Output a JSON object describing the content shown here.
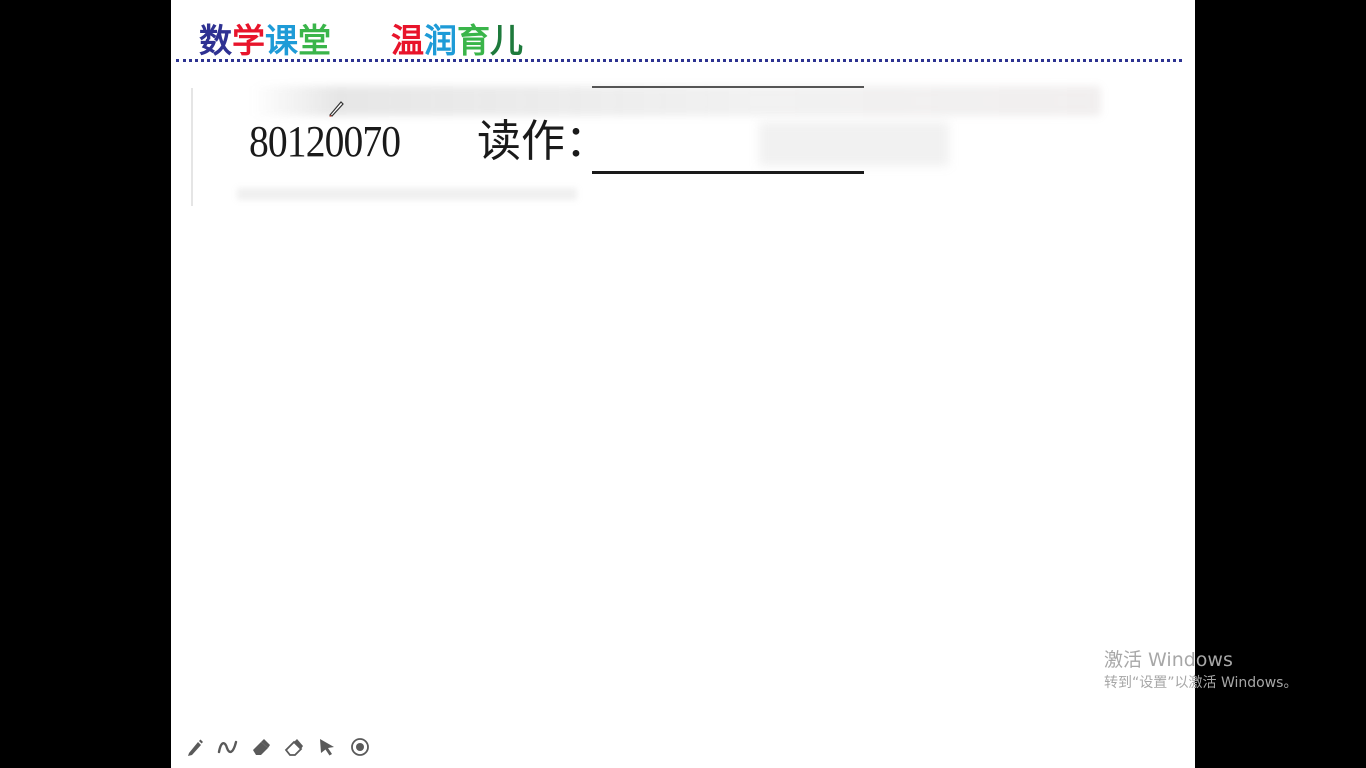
{
  "header": {
    "title_chars": [
      {
        "text": "数",
        "color": "#2e3192"
      },
      {
        "text": "学",
        "color": "#e8142b"
      },
      {
        "text": "课",
        "color": "#1e9bd7"
      },
      {
        "text": "堂",
        "color": "#3ab54a"
      }
    ],
    "slogan_chars": [
      {
        "text": "温",
        "color": "#e8142b"
      },
      {
        "text": "润",
        "color": "#1e9bd7"
      },
      {
        "text": "育",
        "color": "#3ab54a"
      },
      {
        "text": "儿",
        "color": "#1e7a3c"
      }
    ],
    "divider_color": "#2d3391"
  },
  "problem": {
    "number": "80120070",
    "label": "读作："
  },
  "watermark": {
    "title": "激活 Windows",
    "subtitle": "转到“设置”以激活 Windows。"
  },
  "toolbar": {
    "tools": [
      {
        "name": "pen-tool",
        "icon": "pen-icon"
      },
      {
        "name": "ink-tool",
        "icon": "ink-curve-icon"
      },
      {
        "name": "highlighter-tool",
        "icon": "highlighter-icon"
      },
      {
        "name": "eraser-tool",
        "icon": "eraser-icon"
      },
      {
        "name": "pointer-tool",
        "icon": "pointer-arrow-icon"
      },
      {
        "name": "laser-tool",
        "icon": "laser-target-icon"
      }
    ]
  }
}
